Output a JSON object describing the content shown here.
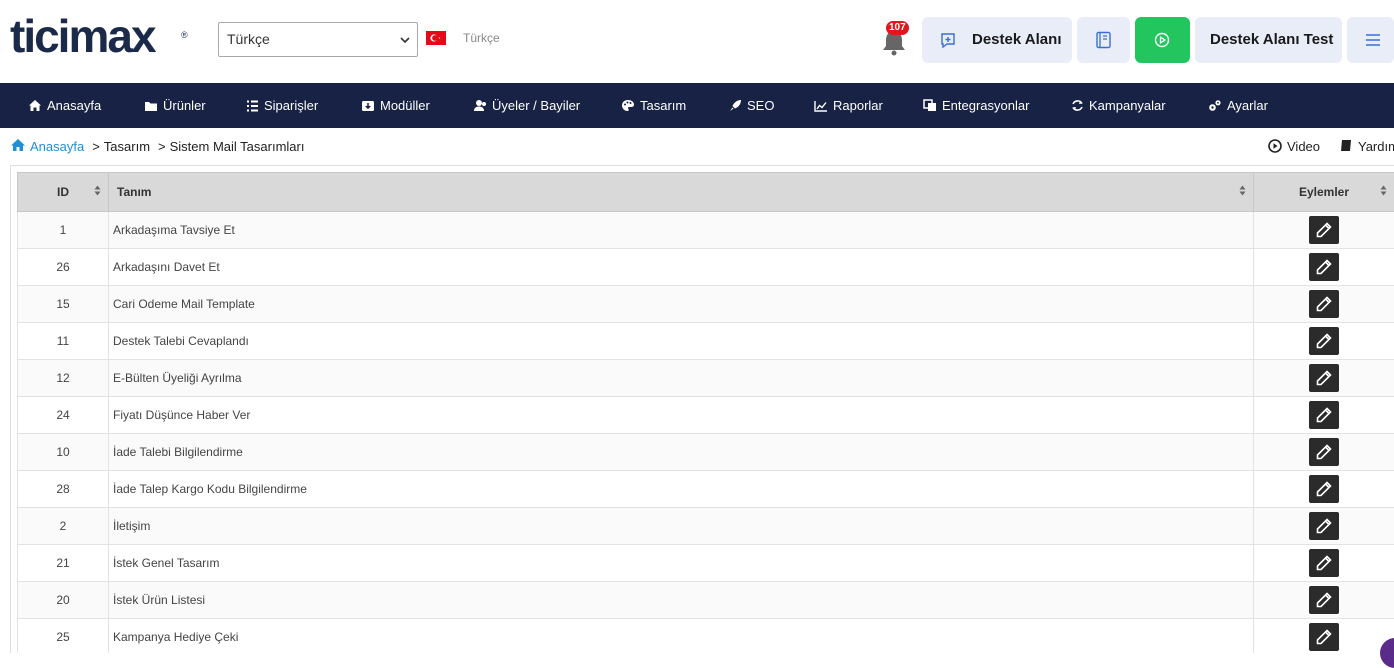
{
  "header": {
    "logo": "ticimax",
    "language_select": {
      "value": "Türkçe"
    },
    "language_label": "Türkçe",
    "notification_count": "107",
    "support_button": "Destek Alanı",
    "user_button": "Destek Alanı Test"
  },
  "nav": [
    {
      "label": "Anasayfa",
      "icon": "home-icon"
    },
    {
      "label": "Ürünler",
      "icon": "folder-icon"
    },
    {
      "label": "Siparişler",
      "icon": "list-icon"
    },
    {
      "label": "Modüller",
      "icon": "download-box-icon"
    },
    {
      "label": "Üyeler / Bayiler",
      "icon": "users-icon"
    },
    {
      "label": "Tasarım",
      "icon": "palette-icon"
    },
    {
      "label": "SEO",
      "icon": "rocket-icon"
    },
    {
      "label": "Raporlar",
      "icon": "chart-icon"
    },
    {
      "label": "Entegrasyonlar",
      "icon": "copy-icon"
    },
    {
      "label": "Kampanyalar",
      "icon": "refresh-icon"
    },
    {
      "label": "Ayarlar",
      "icon": "gears-icon"
    }
  ],
  "breadcrumb": {
    "home": "Anasayfa",
    "items": [
      "Tasarım",
      "Sistem Mail Tasarımları"
    ]
  },
  "help": {
    "video": "Video",
    "help": "Yardım"
  },
  "table": {
    "columns": [
      "ID",
      "Tanım",
      "Eylemler"
    ],
    "rows": [
      {
        "id": "1",
        "name": "Arkadaşıma Tavsiye Et"
      },
      {
        "id": "26",
        "name": "Arkadaşını Davet Et"
      },
      {
        "id": "15",
        "name": "Cari Odeme Mail Template"
      },
      {
        "id": "11",
        "name": "Destek Talebi Cevaplandı"
      },
      {
        "id": "12",
        "name": "E-Bülten Üyeliği Ayrılma"
      },
      {
        "id": "24",
        "name": "Fiyatı Düşünce Haber Ver"
      },
      {
        "id": "10",
        "name": "İade Talebi Bilgilendirme"
      },
      {
        "id": "28",
        "name": "İade Talep Kargo Kodu Bilgilendirme"
      },
      {
        "id": "2",
        "name": "İletişim"
      },
      {
        "id": "21",
        "name": "İstek Genel Tasarım"
      },
      {
        "id": "20",
        "name": "İstek Ürün Listesi"
      },
      {
        "id": "25",
        "name": "Kampanya Hediye Çeki"
      }
    ]
  },
  "colors": {
    "nav_bg": "#172244",
    "accent_green": "#22c55e",
    "link_blue": "#1f8fd6",
    "badge_red": "#e0181e"
  }
}
